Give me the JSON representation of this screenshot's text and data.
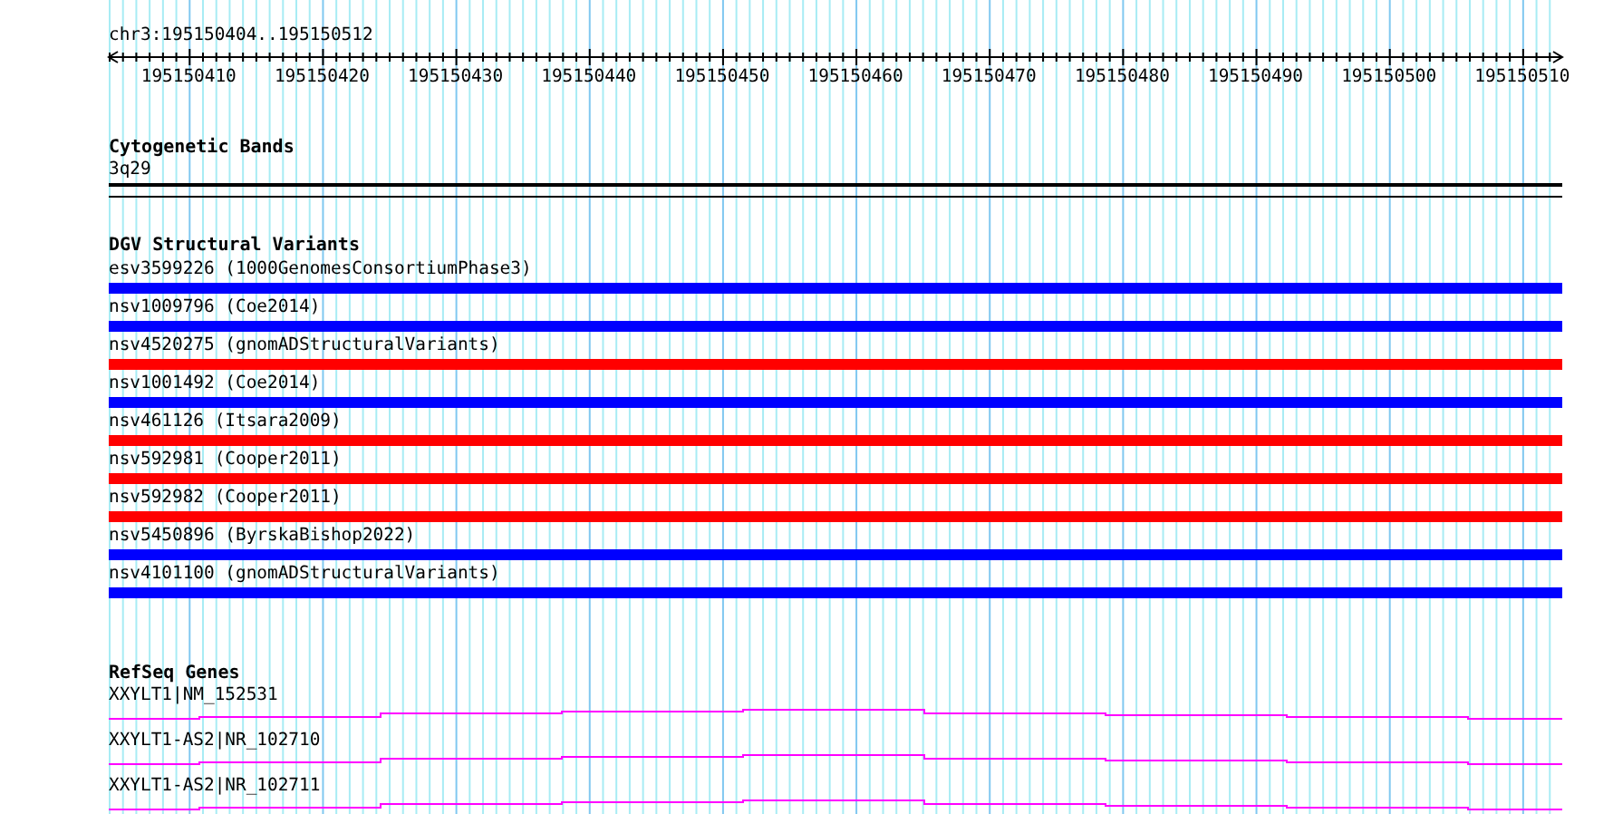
{
  "location": "chr3:195150404..195150512",
  "ruler": {
    "labels": [
      "195150410",
      "195150420",
      "195150430",
      "195150440",
      "195150450",
      "195150460",
      "195150470",
      "195150480",
      "195150490",
      "195150500",
      "195150510"
    ]
  },
  "tracks": [
    {
      "kind": "bands",
      "title": "Cytogenetic Bands",
      "items": [
        {
          "label": "3q29"
        }
      ]
    },
    {
      "kind": "variants",
      "title": "DGV Structural Variants",
      "items": [
        {
          "label": "esv3599226 (1000GenomesConsortiumPhase3)",
          "color": "#0000ff"
        },
        {
          "label": "nsv1009796 (Coe2014)",
          "color": "#0000ff"
        },
        {
          "label": "nsv4520275 (gnomADStructuralVariants)",
          "color": "#ff0000"
        },
        {
          "label": "nsv1001492 (Coe2014)",
          "color": "#0000ff"
        },
        {
          "label": "nsv461126 (Itsara2009)",
          "color": "#ff0000"
        },
        {
          "label": "nsv592981 (Cooper2011)",
          "color": "#ff0000"
        },
        {
          "label": "nsv592982 (Cooper2011)",
          "color": "#ff0000"
        },
        {
          "label": "nsv5450896 (ByrskaBishop2022)",
          "color": "#0000ff"
        },
        {
          "label": "nsv4101100 (gnomADStructuralVariants)",
          "color": "#0000ff"
        }
      ]
    },
    {
      "kind": "genes",
      "title": "RefSeq Genes",
      "items": [
        {
          "label": "XXYLT1|NM_152531"
        },
        {
          "label": "XXYLT1-AS2|NR_102710"
        },
        {
          "label": "XXYLT1-AS2|NR_102711"
        }
      ]
    }
  ]
}
